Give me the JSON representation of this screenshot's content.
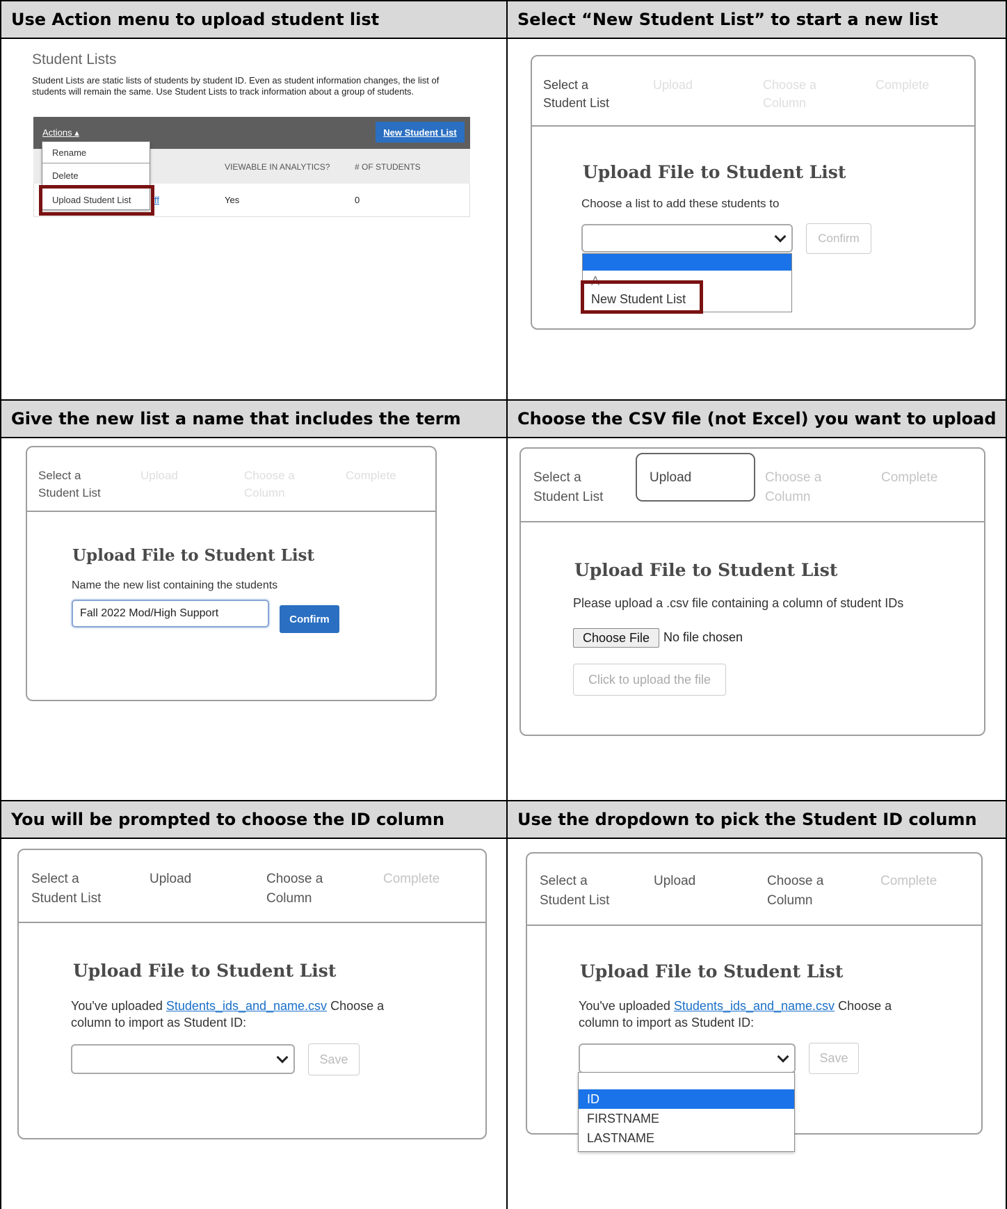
{
  "cells": {
    "c1": {
      "header": "Use Action menu to upload student list"
    },
    "c2": {
      "header": "Select “New Student List” to start a new list"
    },
    "c3": {
      "header": "Give the new list a name that includes the term"
    },
    "c4": {
      "header": "Choose the CSV file (not Excel) you want to upload"
    },
    "c5": {
      "header": "You will be prompted to choose the ID column"
    },
    "c6": {
      "header": "Use the dropdown to pick the Student ID column"
    }
  },
  "student_lists": {
    "title": "Student Lists",
    "description": "Student Lists are static lists of students by student ID. Even as student information changes, the list of students will remain the same. Use Student Lists to track information about a group of students.",
    "actions_label": "Actions ▴",
    "new_list_button": "New Student List",
    "menu": [
      "Rename",
      "Delete",
      "Upload Student List"
    ],
    "columns": {
      "viewable": "VIEWABLE IN ANALYTICS?",
      "count": "# OF STUDENTS"
    },
    "row": {
      "name_fragment": "ff",
      "viewable": "Yes",
      "count": "0"
    }
  },
  "wizard": {
    "steps": {
      "select_1": "Select a",
      "select_2": "Student List",
      "upload": "Upload",
      "choose_1": "Choose a",
      "choose_2": "Column",
      "complete": "Complete"
    },
    "title": "Upload File to Student List"
  },
  "panel2": {
    "prompt": "Choose a list to add these students to",
    "confirm": "Confirm",
    "options": [
      "",
      "A",
      "New Student List"
    ]
  },
  "panel3": {
    "prompt": "Name the new list containing the students",
    "name_value": "Fall 2022 Mod/High Support",
    "confirm": "Confirm"
  },
  "panel4": {
    "prompt": "Please upload a .csv file containing a column of student IDs",
    "choose_file": "Choose File",
    "no_file": "No file chosen",
    "upload_button": "Click to upload the file"
  },
  "panel5": {
    "prefix": "You've uploaded ",
    "file_link": "Students_ids_and_name.csv",
    "suffix": " Choose a column to import as Student ID:",
    "save": "Save"
  },
  "panel6": {
    "prefix": "You've uploaded ",
    "file_link": "Students_ids_and_name.csv",
    "suffix": " Choose a column to import as Student ID:",
    "save": "Save",
    "options": [
      "",
      "ID",
      "FIRSTNAME",
      "LASTNAME"
    ]
  }
}
